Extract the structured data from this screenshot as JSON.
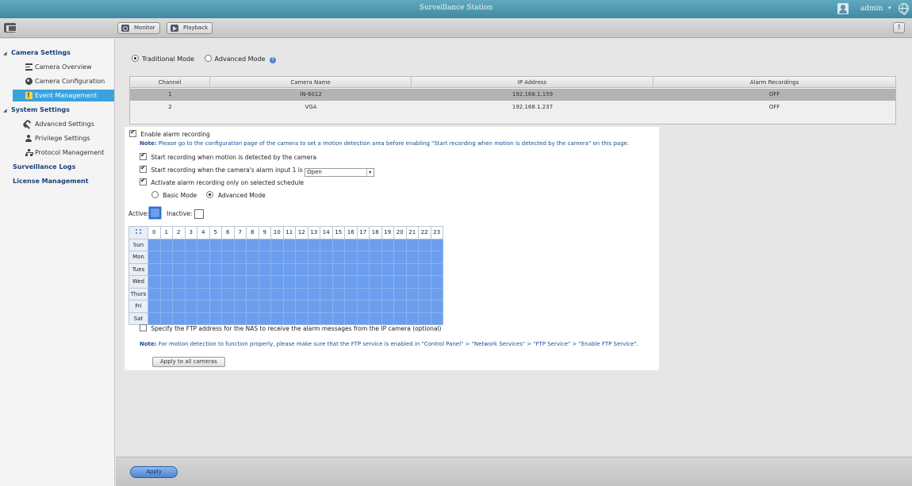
{
  "app": {
    "title": "Surveillance Station",
    "username": "admin"
  },
  "toolbar": {
    "monitor_label": "Monitor",
    "playback_label": "Playback",
    "help_label": "?"
  },
  "sidebar": {
    "camera_settings": "Camera Settings",
    "camera_overview": "Camera Overview",
    "camera_configuration": "Camera Configuration",
    "event_management": "Event Management",
    "system_settings": "System Settings",
    "advanced_settings": "Advanced Settings",
    "privilege_settings": "Privilege Settings",
    "protocol_management": "Protocol Management",
    "surveillance_logs": "Surveillance Logs",
    "license_management": "License Management"
  },
  "mode": {
    "traditional": "Traditional Mode",
    "advanced": "Advanced Mode",
    "selected": "Traditional Mode"
  },
  "camera_table": {
    "headers": [
      "Channel",
      "Camera Name",
      "IP Address",
      "Alarm Recordings"
    ],
    "rows": [
      [
        "1",
        "IN-6012",
        "192.168.1.159",
        "OFF"
      ],
      [
        "2",
        "VGA",
        "192.168.1.237",
        "OFF"
      ]
    ],
    "selected_row": 1
  },
  "alarm": {
    "enable_label": "Enable alarm recording",
    "enable_checked": true,
    "note_label": "Note:",
    "note_text": " Please go to the configuration page of the camera to set a motion detection area before enabling \"Start recording when motion is detected by the camera\" on this page.",
    "motion_label": "Start recording when motion is detected by the camera",
    "alarm_input_label": "Start recording when the camera's alarm input 1 is",
    "alarm_input_value": "Open",
    "schedule_label": "Activate alarm recording only on selected schedule",
    "basic_mode": "Basic Mode",
    "advanced_mode": "Advanced Mode",
    "schedule_mode_selected": "Advanced Mode",
    "active_label": "Active:",
    "inactive_label": "Inactive:"
  },
  "schedule": {
    "hours": [
      "0",
      "1",
      "2",
      "3",
      "4",
      "5",
      "6",
      "7",
      "8",
      "9",
      "10",
      "11",
      "12",
      "13",
      "14",
      "15",
      "16",
      "17",
      "18",
      "19",
      "20",
      "21",
      "22",
      "23"
    ],
    "days": [
      "Sun",
      "Mon",
      "Tues",
      "Wed",
      "Thurs",
      "Fri",
      "Sat"
    ],
    "all_active": true
  },
  "ftp": {
    "label": "Specify the FTP address for the NAS to receive the alarm messages from the IP camera (optional)",
    "checked": false,
    "note_label": "Note:",
    "note_text": " For motion detection to function properly, please make sure that the FTP service is enabled in \"Control Panel\" > \"Network Services\" > \"FTP Service\" > \"Enable FTP Service\"."
  },
  "buttons": {
    "apply_all": "Apply to all cameras",
    "apply": "Apply"
  },
  "colors": {
    "titlebar": "#4f9ab3",
    "active_slot": "#6d9ded",
    "selected_nav": "#3ba2dc",
    "note_text": "#1d4b9a"
  }
}
